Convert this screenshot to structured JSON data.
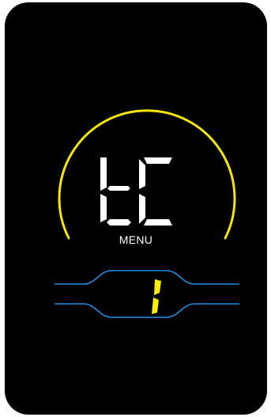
{
  "display": {
    "mode_code": "tC",
    "label": "MENU",
    "value": "1"
  },
  "colors": {
    "background": "#000000",
    "arc": "#f5e50a",
    "mode_digits": "#ffffff",
    "value_digit": "#ffee00",
    "channel_lines": "#1e8ee8",
    "label_text": "#ffffff"
  }
}
